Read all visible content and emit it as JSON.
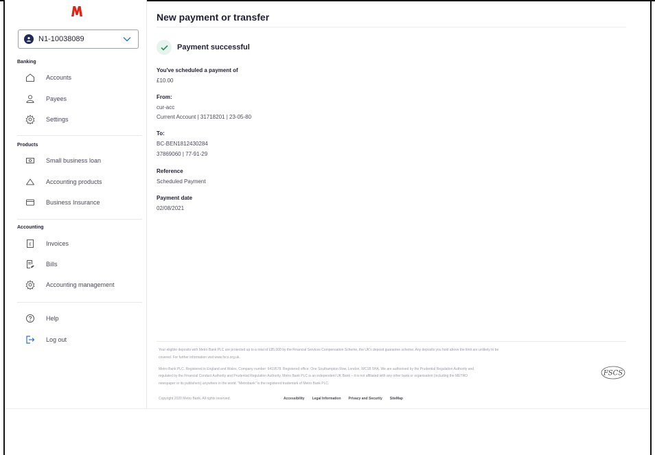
{
  "brand": {
    "logo_letter": "M",
    "accent": "#e2231a",
    "navy": "#1f2a5a",
    "success_green": "#2e8b57"
  },
  "sidebar": {
    "account_selector": {
      "label": "N1-10038089",
      "icon": "user-icon"
    },
    "sections": [
      {
        "title": "Banking",
        "items": [
          {
            "label": "Accounts",
            "icon": "home-icon"
          },
          {
            "label": "Payees",
            "icon": "person-icon"
          },
          {
            "label": "Settings",
            "icon": "gear-icon"
          }
        ]
      },
      {
        "title": "Products",
        "items": [
          {
            "label": "Small business loan",
            "icon": "banknote-icon"
          },
          {
            "label": "Accounting products",
            "icon": "cloud-icon"
          },
          {
            "label": "Business Insurance",
            "icon": "card-icon"
          }
        ]
      },
      {
        "title": "Accounting",
        "items": [
          {
            "label": "Invoices",
            "icon": "invoice-icon"
          },
          {
            "label": "Bills",
            "icon": "bill-icon"
          },
          {
            "label": "Accounting management",
            "icon": "gear-icon"
          }
        ]
      }
    ],
    "bottom_items": [
      {
        "label": "Help",
        "icon": "question-icon"
      },
      {
        "label": "Log out",
        "icon": "logout-icon"
      }
    ]
  },
  "main": {
    "title": "New payment or transfer",
    "status": {
      "text": "Payment successful",
      "icon": "check-icon"
    },
    "details": {
      "amount_label": "You've scheduled a payment of",
      "amount_value": "£10.00",
      "from_label": "From:",
      "from_name": "cur-acc",
      "from_account": "Current Account | 31718201 | 23-05-80",
      "to_label": "To:",
      "to_name": "BC-BEN1812430284",
      "to_account": "37869060 | 77-91-29",
      "reference_label": "Reference",
      "reference_value": "Scheduled Payment",
      "date_label": "Payment date",
      "date_value": "02/08/2021"
    }
  },
  "footer": {
    "deposit_line1": "Your eligible deposits with Metro Bank PLC are protected up to a total of £85,000 by the Financial Services Compensation Scheme, the UK's deposit guarantee scheme. Any deposits you hold above the limit are unlikely to be",
    "deposit_line2": "covered. For further information visit www.fscs.org.uk.",
    "legal_line1": "Metro Bank PLC. Registered in England and Wales. Company number: 6419578. Registered office: One Southampton Row, London, WC1B 5HA. We are authorised by the Prudential Regulation Authority and",
    "legal_line2": "regulated by the Financial Conduct Authority and Prudential Regulation Authority. Metro Bank PLC is an independent UK Bank – it is not affiliated with any other bank or organisation (including the METRO",
    "legal_line3": "newspaper or its publishers) anywhere in the world. \"Metrobank\" is the registered trademark of Metro Bank PLC.",
    "copyright": "Copyright 2020 Metro Bank. All rights reserved.",
    "links": [
      "Accessibility",
      "Legal Information",
      "Privacy and Security",
      "SiteMap"
    ],
    "fscs_logo_text": "FSCS"
  }
}
